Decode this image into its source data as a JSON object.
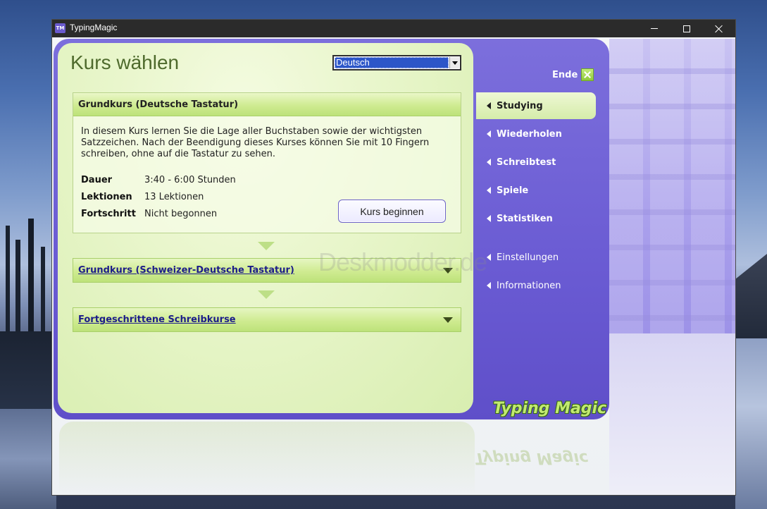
{
  "window": {
    "title": "TypingMagic",
    "app_icon_text": "TM",
    "controls": {
      "minimize": "minimize",
      "maximize": "maximize",
      "close": "close"
    }
  },
  "page": {
    "title": "Kurs wählen",
    "language_select": {
      "value": "Deutsch"
    }
  },
  "course_main": {
    "title": "Grundkurs (Deutsche Tastatur)",
    "description": "In diesem Kurs lernen Sie die Lage aller Buchstaben sowie der wichtigsten Satzzeichen. Nach der Beendigung dieses Kurses können Sie mit 10 Fingern schreiben, ohne auf die Tastatur zu sehen.",
    "details": [
      {
        "label": "Dauer",
        "value": "3:40 - 6:00 Stunden"
      },
      {
        "label": "Lektionen",
        "value": "13 Lektionen"
      },
      {
        "label": "Fortschritt",
        "value": "Nicht begonnen"
      }
    ],
    "begin_button": "Kurs beginnen"
  },
  "courses_collapsed": [
    {
      "title": "Grundkurs (Schweizer-Deutsche Tastatur)"
    },
    {
      "title": "Fortgeschrittene Schreibkurse"
    }
  ],
  "watermark": "Deskmodder.de",
  "sidebar": {
    "exit_label": "Ende",
    "items": [
      {
        "label": "Studying",
        "active": true
      },
      {
        "label": "Wiederholen"
      },
      {
        "label": "Schreibtest"
      },
      {
        "label": "Spiele"
      },
      {
        "label": "Statistiken"
      },
      {
        "label": "Einstellungen"
      },
      {
        "label": "Informationen"
      }
    ],
    "brand": "Typing Magic"
  },
  "colors": {
    "panel_green": "#e9f6cc",
    "frame_purple": "#6a5bd3",
    "title_green": "#4e6a2c",
    "link_blue": "#1c1c8a"
  }
}
